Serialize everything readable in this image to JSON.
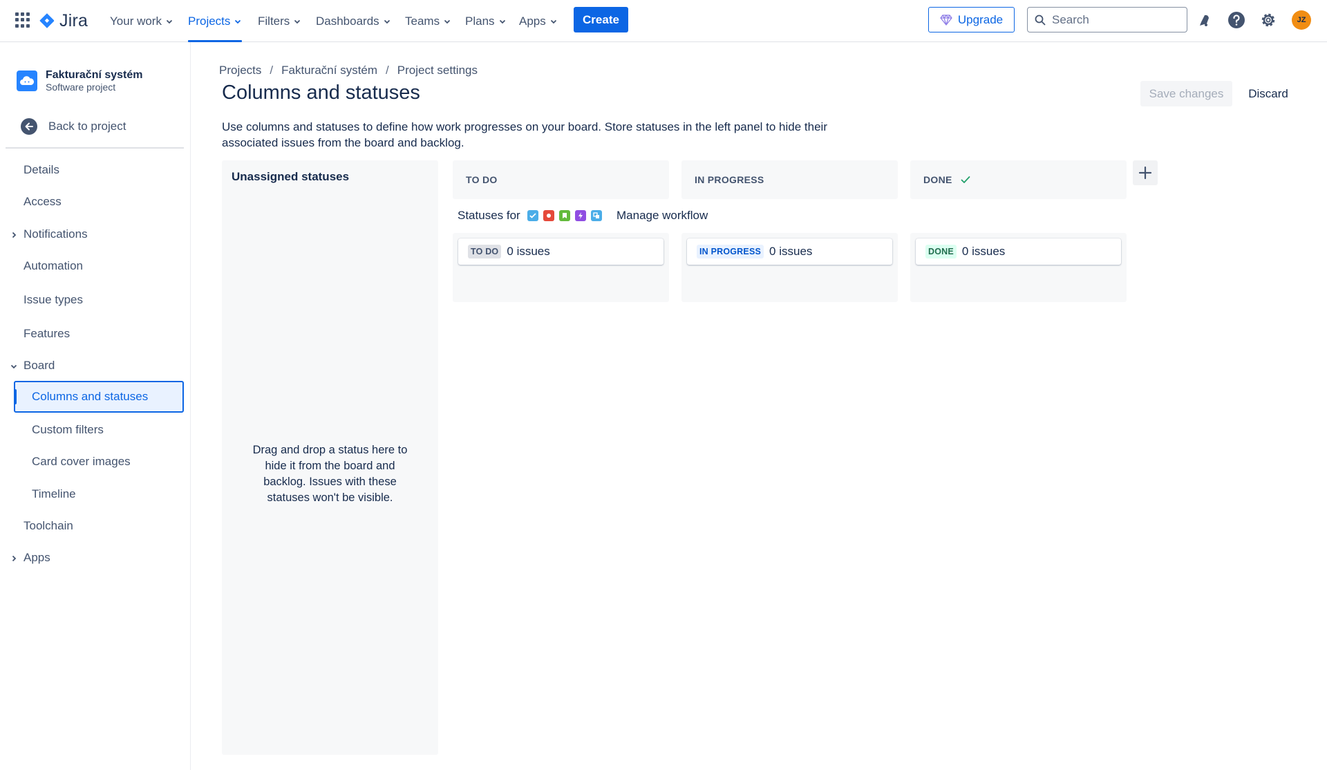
{
  "nav": {
    "logo": "Jira",
    "items": [
      {
        "label": "Your work"
      },
      {
        "label": "Projects"
      },
      {
        "label": "Filters"
      },
      {
        "label": "Dashboards"
      },
      {
        "label": "Teams"
      },
      {
        "label": "Plans"
      },
      {
        "label": "Apps"
      }
    ],
    "create_label": "Create",
    "upgrade_label": "Upgrade",
    "search_placeholder": "Search",
    "avatar_initials": "JZ",
    "accent_color": "#0c66e4"
  },
  "sidebar": {
    "project_name": "Fakturační systém",
    "project_type": "Software project",
    "back_label": "Back to project",
    "items": [
      {
        "label": "Details"
      },
      {
        "label": "Access"
      },
      {
        "label": "Notifications"
      },
      {
        "label": "Automation"
      },
      {
        "label": "Issue types"
      },
      {
        "label": "Features"
      },
      {
        "label": "Board"
      },
      {
        "label": "Columns and statuses"
      },
      {
        "label": "Custom filters"
      },
      {
        "label": "Card cover images"
      },
      {
        "label": "Timeline"
      },
      {
        "label": "Toolchain"
      },
      {
        "label": "Apps"
      }
    ]
  },
  "main": {
    "breadcrumb": [
      "Projects",
      "Fakturační systém",
      "Project settings"
    ],
    "title": "Columns and statuses",
    "save_label": "Save changes",
    "discard_label": "Discard",
    "description": "Use columns and statuses to define how work progresses on your board. Store statuses in the left panel to hide their associated issues from the board and backlog.",
    "unassigned_title": "Unassigned statuses",
    "unassigned_hint": "Drag and drop a status here to hide it from the board and backlog. Issues with these statuses won't be visible.",
    "statuses_for_label": "Statuses for",
    "manage_workflow_label": "Manage workflow",
    "columns": [
      {
        "header": "TO DO",
        "status": "TO DO",
        "count": "0",
        "unit": "issues"
      },
      {
        "header": "IN PROGRESS",
        "status": "IN PROGRESS",
        "count": "0",
        "unit": "issues"
      },
      {
        "header": "DONE",
        "status": "DONE",
        "count": "0",
        "unit": "issues"
      }
    ],
    "issue_type_icons": [
      "task-icon",
      "bug-icon",
      "story-icon",
      "epic-icon",
      "subtask-icon"
    ]
  }
}
